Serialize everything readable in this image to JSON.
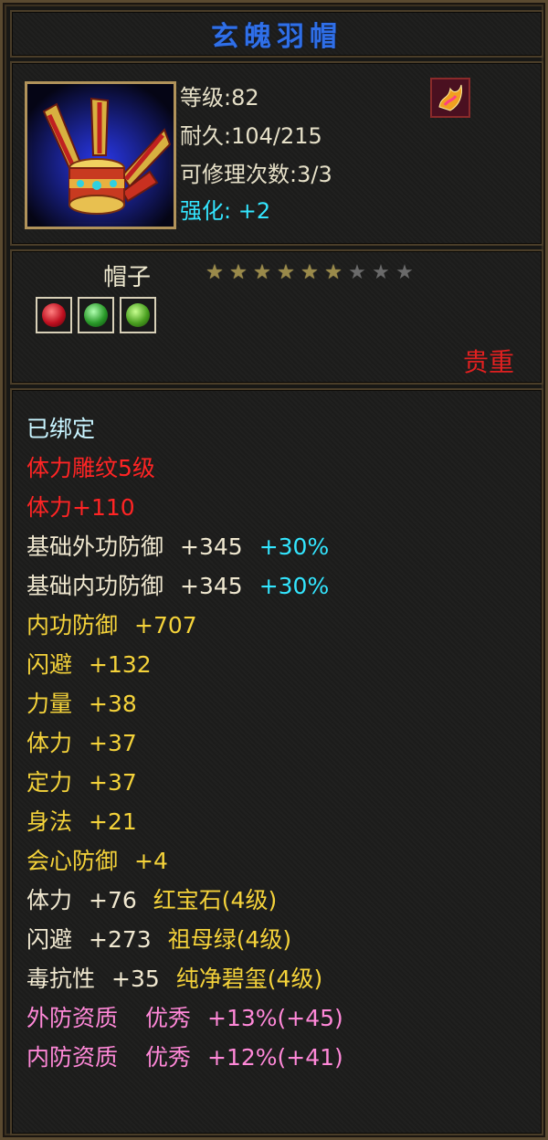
{
  "item": {
    "name": "玄魄羽帽",
    "level": "等级:82",
    "durability": "耐久:104/215",
    "repair": "可修理次数:3/3",
    "enhance_label": "强化:",
    "enhance_value": "+2",
    "type": "帽子",
    "stars_filled": 6,
    "stars_total": 9,
    "rarity": "贵重",
    "gems": [
      "red-gem-icon",
      "green-gem-icon",
      "green-gem-icon"
    ]
  },
  "details": {
    "bound": "已绑定",
    "engrave": "体力雕纹5级",
    "engrave_bonus": "体力+110",
    "base_ext_def": {
      "label": "基础外功防御",
      "value": "+345",
      "pct": "+30%"
    },
    "base_int_def": {
      "label": "基础内功防御",
      "value": "+345",
      "pct": "+30%"
    },
    "int_def": {
      "label": "内功防御",
      "value": "+707"
    },
    "dodge": {
      "label": "闪避",
      "value": "+132"
    },
    "strength": {
      "label": "力量",
      "value": "+38"
    },
    "stamina": {
      "label": "体力",
      "value": "+37"
    },
    "focus": {
      "label": "定力",
      "value": "+37"
    },
    "agility": {
      "label": "身法",
      "value": "+21"
    },
    "crit_def": {
      "label": "会心防御",
      "value": "+4"
    },
    "gem1": {
      "label": "体力",
      "value": "+76",
      "gem": "红宝石(4级)"
    },
    "gem2": {
      "label": "闪避",
      "value": "+273",
      "gem": "祖母绿(4级)"
    },
    "gem3": {
      "label": "毒抗性",
      "value": "+35",
      "gem": "纯净碧玺(4级)"
    },
    "apt1": {
      "label": "外防资质",
      "grade": "优秀",
      "value": "+13%(+45)"
    },
    "apt2": {
      "label": "内防资质",
      "grade": "优秀",
      "value": "+12%(+41)"
    }
  },
  "colors": {
    "title": "#2f6fe8",
    "enhance": "#33e6ff",
    "engrave": "#ff2424",
    "stat": "#f4d23a",
    "aptitude": "#ff88d8"
  }
}
